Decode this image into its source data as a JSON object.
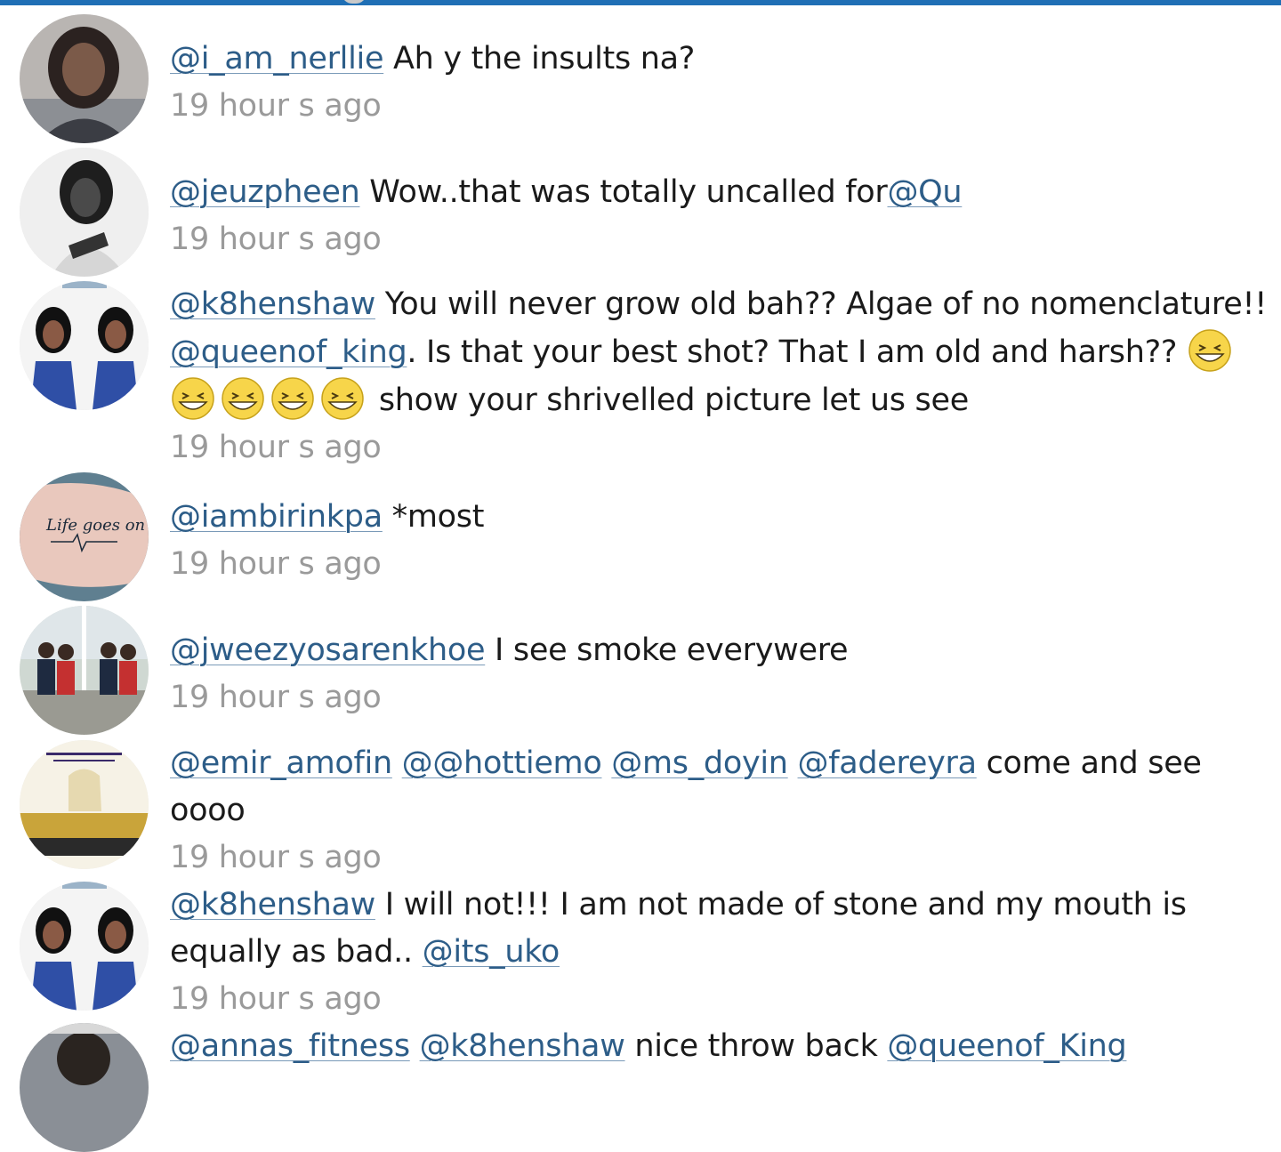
{
  "colors": {
    "accent": "#1f6fb5",
    "mention": "#2d5d88",
    "timestamp": "#9a9a9a",
    "text": "#1a1a1a"
  },
  "comments": [
    {
      "avatar_icon": "user-avatar-photo",
      "parts": [
        {
          "type": "mention",
          "text": "@i_am_nerllie"
        },
        {
          "type": "text",
          "text": " Ah y the insults na?"
        }
      ],
      "timestamp": "19 hour s ago"
    },
    {
      "avatar_icon": "user-avatar-photo",
      "parts": [
        {
          "type": "mention",
          "text": "@jeuzpheen"
        },
        {
          "type": "text",
          "text": " Wow..that was totally uncalled for"
        },
        {
          "type": "mention",
          "text": "@Qu"
        }
      ],
      "timestamp": "19 hour s ago"
    },
    {
      "avatar_icon": "user-avatar-photo",
      "parts": [
        {
          "type": "mention",
          "text": "@k8henshaw"
        },
        {
          "type": "text",
          "text": " You will never grow old bah?? Algae of no nomenclature!! "
        },
        {
          "type": "mention",
          "text": "@queenof_king"
        },
        {
          "type": "text",
          "text": ". Is that your best shot? That I am old and harsh?? "
        },
        {
          "type": "emoji",
          "name": "grinning-squinting-face-icon",
          "count": 5
        },
        {
          "type": "text",
          "text": " show your shrivelled picture let us see"
        }
      ],
      "timestamp": "19 hour s ago"
    },
    {
      "avatar_icon": "user-avatar-photo",
      "parts": [
        {
          "type": "mention",
          "text": "@iambirinkpa"
        },
        {
          "type": "text",
          "text": " *most"
        }
      ],
      "timestamp": "19 hour s ago"
    },
    {
      "avatar_icon": "user-avatar-photo",
      "parts": [
        {
          "type": "mention",
          "text": "@jweezyosarenkhoe"
        },
        {
          "type": "text",
          "text": " I see smoke everywere"
        }
      ],
      "timestamp": "19 hour s ago"
    },
    {
      "avatar_icon": "user-avatar-photo",
      "parts": [
        {
          "type": "mention",
          "text": "@emir_amofin"
        },
        {
          "type": "text",
          "text": " "
        },
        {
          "type": "mention",
          "text": "@@hottiemo"
        },
        {
          "type": "text",
          "text": " "
        },
        {
          "type": "mention",
          "text": "@ms_doyin"
        },
        {
          "type": "text",
          "text": " "
        },
        {
          "type": "mention",
          "text": "@fadereyra"
        },
        {
          "type": "text",
          "text": " come and see oooo"
        }
      ],
      "timestamp": "19 hour s ago"
    },
    {
      "avatar_icon": "user-avatar-photo",
      "parts": [
        {
          "type": "mention",
          "text": "@k8henshaw"
        },
        {
          "type": "text",
          "text": " I will not!!! I am not made of stone and my mouth is equally as bad.. "
        },
        {
          "type": "mention",
          "text": "@its_uko"
        }
      ],
      "timestamp": "19 hour s ago"
    },
    {
      "avatar_icon": "user-avatar-photo",
      "parts": [
        {
          "type": "mention",
          "text": "@annas_fitness"
        },
        {
          "type": "text",
          "text": " "
        },
        {
          "type": "mention",
          "text": "@k8henshaw"
        },
        {
          "type": "text",
          "text": " nice throw back "
        },
        {
          "type": "mention",
          "text": "@queenof_King"
        }
      ],
      "timestamp": ""
    }
  ]
}
